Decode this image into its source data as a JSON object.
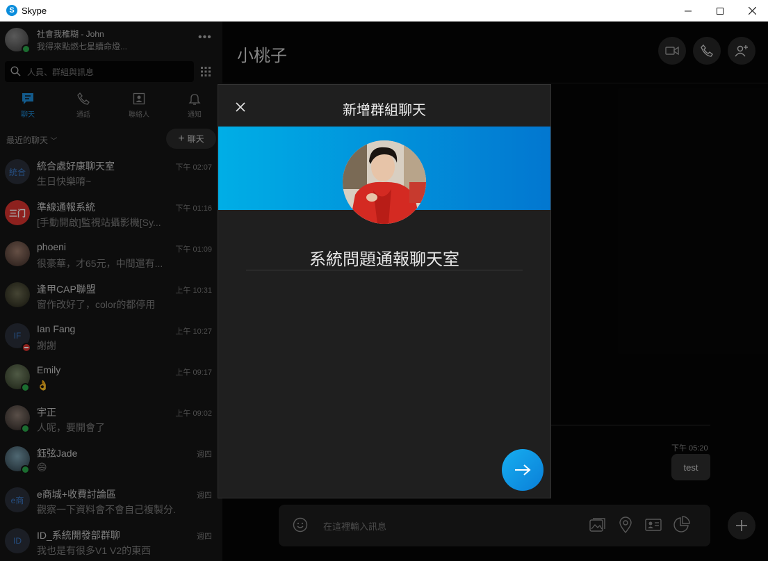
{
  "window": {
    "title": "Skype",
    "minimize_icon": "minimize-icon",
    "maximize_icon": "maximize-icon",
    "close_icon": "close-icon"
  },
  "profile": {
    "name": "社會我稚糊 - John",
    "status": "我得來點燃七星續命燈..."
  },
  "search": {
    "placeholder": "人員、群組與訊息"
  },
  "nav": {
    "chats": "聊天",
    "calls": "通話",
    "contacts": "聯絡人",
    "notifications": "通知"
  },
  "recent_label": "最近的聊天",
  "new_chat_label": "聊天",
  "chats": [
    {
      "initials": "統合",
      "name": "統合處好康聊天室",
      "preview": "生日快樂唷~",
      "time": "下午 02:07",
      "status": "none"
    },
    {
      "initials": "",
      "name": "準線通報系統",
      "preview": "[手動開啟]監視站攝影機[Sy...",
      "time": "下午 01:16",
      "status": "none"
    },
    {
      "initials": "",
      "name": "phoeni",
      "preview": "很豪華，才65元，中間還有...",
      "time": "下午 01:09",
      "status": "none"
    },
    {
      "initials": "",
      "name": "逢甲CAP聯盟",
      "preview": "窗作改好了，color的都停用",
      "time": "上午 10:31",
      "status": "none"
    },
    {
      "initials": "IF",
      "name": "Ian Fang",
      "preview": "謝謝",
      "time": "上午 10:27",
      "status": "dnd"
    },
    {
      "initials": "",
      "name": "Emily",
      "preview": "👌",
      "time": "上午 09:17",
      "status": "online"
    },
    {
      "initials": "",
      "name": "宇正",
      "preview": "人呢，要開會了",
      "time": "上午 09:02",
      "status": "online"
    },
    {
      "initials": "",
      "name": "鈺弦Jade",
      "preview": "😄",
      "time": "週四",
      "status": "online"
    },
    {
      "initials": "e商",
      "name": "e商城+收費討論區",
      "preview": "觀察一下資料會不會自己複製分...",
      "time": "週四",
      "status": "none"
    },
    {
      "initials": "ID",
      "name": "ID_系統開發部群聊",
      "preview": "我也是有很多V1 V2的東西",
      "time": "週四",
      "status": "none"
    }
  ],
  "conversation": {
    "title": "小桃子",
    "message_time": "下午 05:20",
    "message_text": "test",
    "composer_placeholder": "在這裡輸入訊息"
  },
  "modal": {
    "title": "新增群組聊天",
    "group_name": "系統問題通報聊天室"
  },
  "colors": {
    "accent": "#0a84d8",
    "banner_start": "#00aee6",
    "banner_end": "#0277d0",
    "online": "#2aa84a",
    "dnd": "#d9332e"
  }
}
